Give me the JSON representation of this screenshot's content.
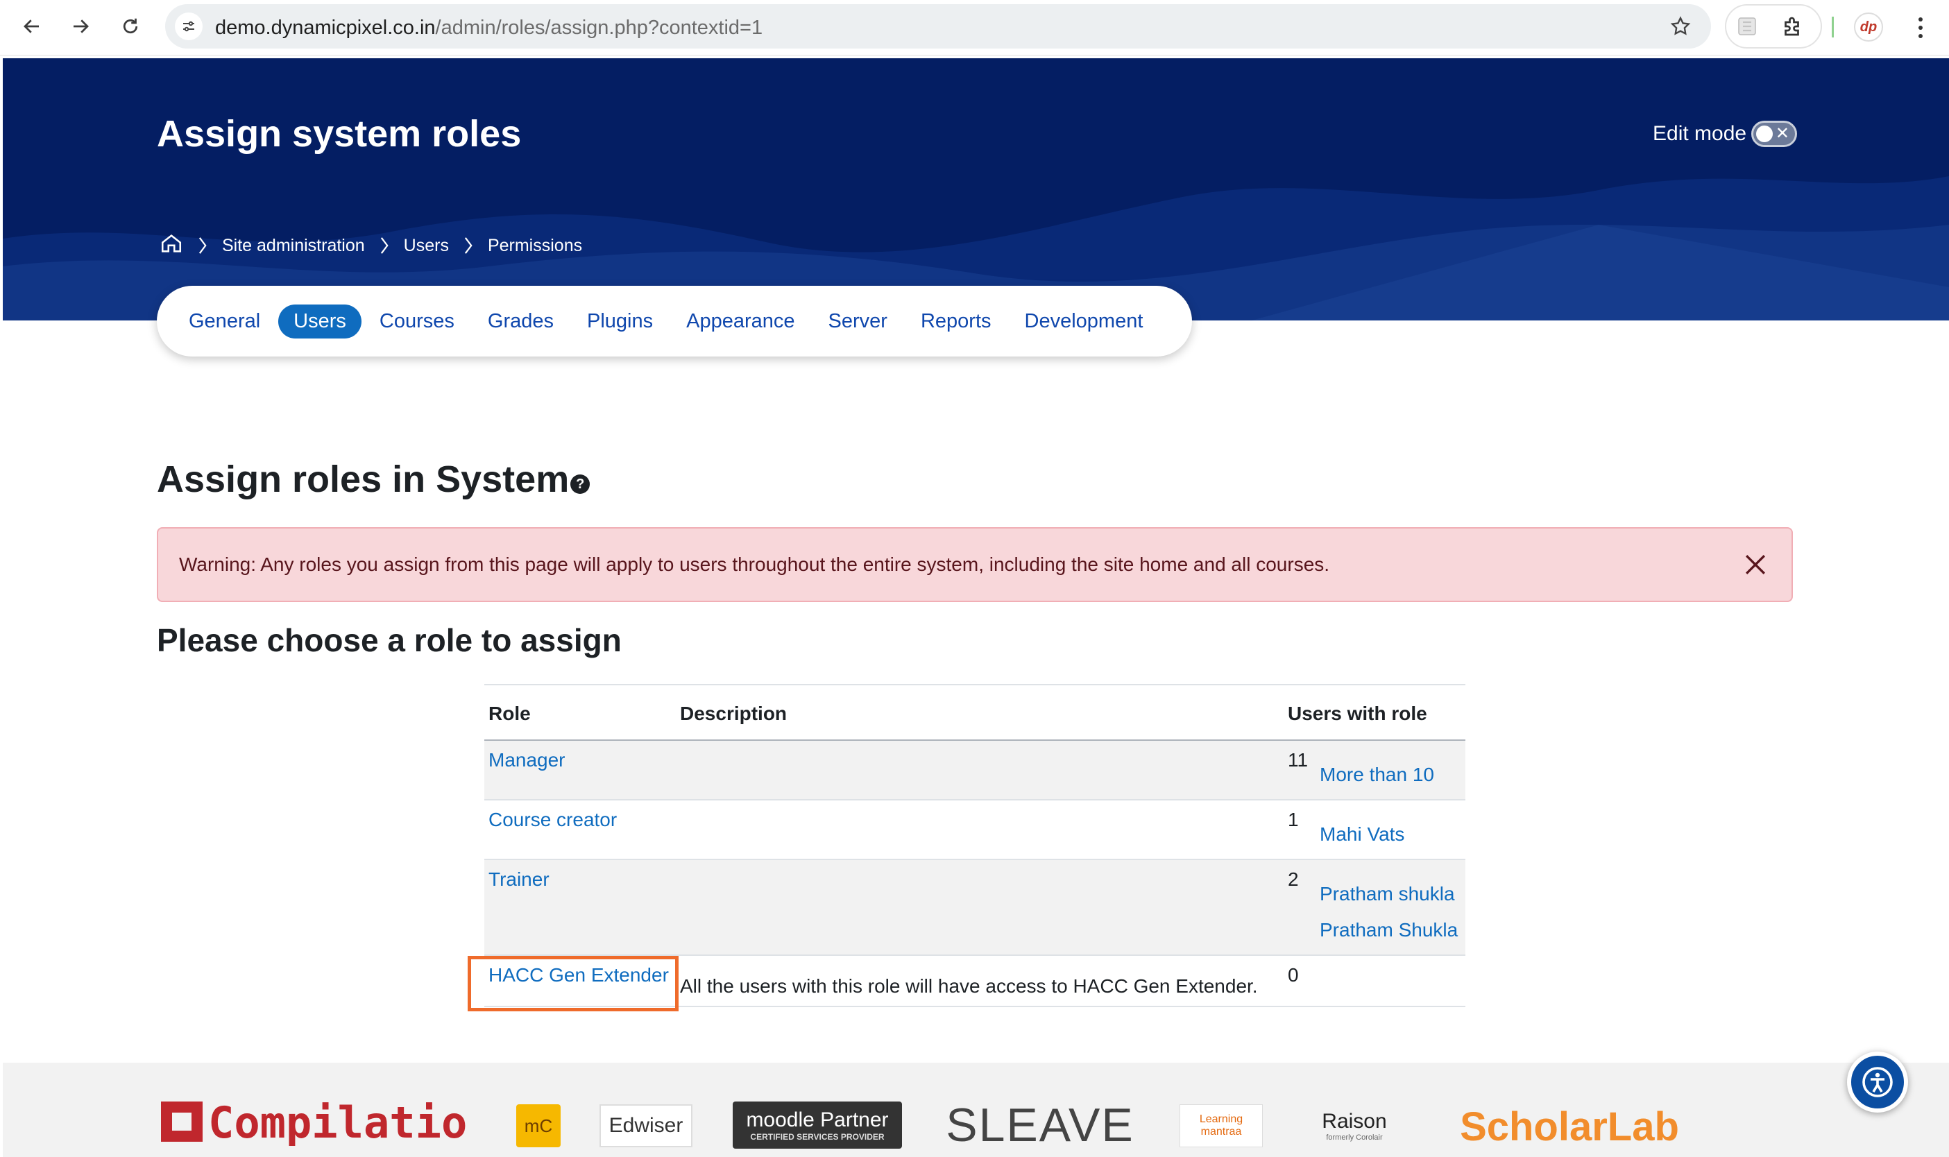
{
  "browser": {
    "url_host": "demo.dynamicpixel.co.in",
    "url_path": "/admin/roles/assign.php?contextid=1",
    "profile_initials": "dp"
  },
  "header": {
    "page_title": "Assign system roles",
    "edit_mode_label": "Edit mode",
    "edit_mode_on": false,
    "breadcrumb": [
      "Site administration",
      "Users",
      "Permissions"
    ]
  },
  "secondary_nav": {
    "items": [
      "General",
      "Users",
      "Courses",
      "Grades",
      "Plugins",
      "Appearance",
      "Server",
      "Reports",
      "Development"
    ],
    "active": "Users"
  },
  "main": {
    "heading": "Assign roles in System",
    "help_icon": "question-circle-icon",
    "alert": "Warning: Any roles you assign from this page will apply to users throughout the entire system, including the site home and all courses.",
    "subheading": "Please choose a role to assign",
    "table": {
      "headers": [
        "Role",
        "Description",
        "Users with role"
      ],
      "rows": [
        {
          "role": "Manager",
          "description": "",
          "count": "11",
          "users": [
            "More than 10"
          ]
        },
        {
          "role": "Course creator",
          "description": "",
          "count": "1",
          "users": [
            "Mahi Vats"
          ]
        },
        {
          "role": "Trainer",
          "description": "",
          "count": "2",
          "users": [
            "Pratham shukla",
            "Pratham Shukla"
          ]
        },
        {
          "role": "HACC Gen Extender",
          "description": "All the users with this role will have access to HACC Gen Extender.",
          "count": "0",
          "users": []
        }
      ]
    }
  },
  "footer": {
    "partner_logos": [
      "Compilatio",
      "mC",
      "Edwiser",
      "moodle Partner",
      "CERTIFIED SERVICES PROVIDER",
      "SLEAVE",
      "Learning mantraa",
      "Raison",
      "formerly Corolair",
      "ScholarLab"
    ]
  },
  "colors": {
    "banner": "#041e63",
    "primary": "#0f6cbf",
    "alert_bg": "#f8d7da",
    "highlight": "#ef6b2b"
  }
}
